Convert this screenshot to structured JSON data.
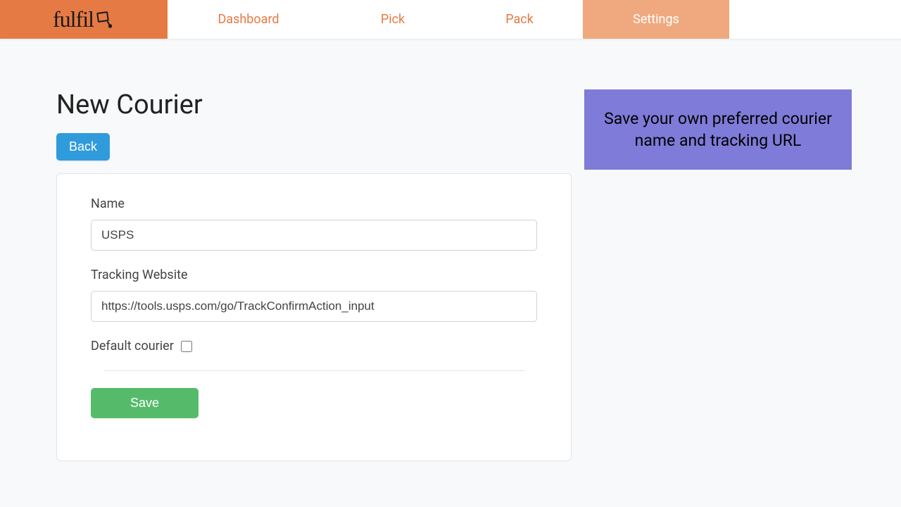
{
  "brand": {
    "name": "fulfil"
  },
  "nav": {
    "items": [
      {
        "label": "Dashboard",
        "active": false
      },
      {
        "label": "Pick",
        "active": false
      },
      {
        "label": "Pack",
        "active": false
      },
      {
        "label": "Settings",
        "active": true
      }
    ]
  },
  "page": {
    "title": "New Courier",
    "back_label": "Back"
  },
  "form": {
    "name_label": "Name",
    "name_value": "USPS",
    "tracking_label": "Tracking Website",
    "tracking_value": "https://tools.usps.com/go/TrackConfirmAction_input",
    "default_label": "Default courier",
    "default_checked": false,
    "save_label": "Save"
  },
  "info_banner": {
    "text": "Save your own preferred courier name and tracking URL"
  }
}
